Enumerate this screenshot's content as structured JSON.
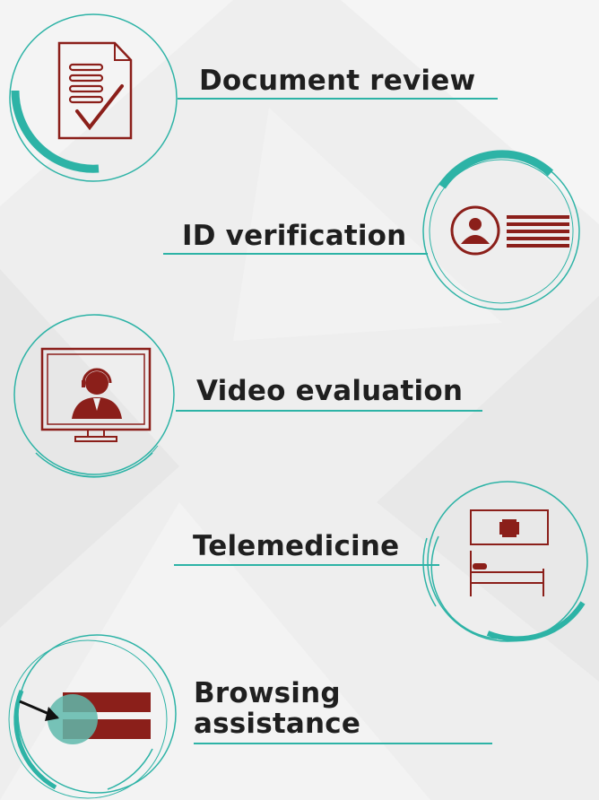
{
  "colors": {
    "background": "#eeeeee",
    "teal": "#2db3a6",
    "teal_light": "#7fd0c8",
    "maroon": "#8b1f1a",
    "text": "#1f1f1f"
  },
  "items": [
    {
      "label": "Document review",
      "icon": "document-check-icon"
    },
    {
      "label": "ID verification",
      "icon": "id-card-icon"
    },
    {
      "label": "Video evaluation",
      "icon": "video-call-monitor-icon"
    },
    {
      "label": "Telemedicine",
      "icon": "hospital-bed-icon"
    },
    {
      "label_line1": "Browsing",
      "label_line2": "assistance",
      "icon": "screen-pointer-icon"
    }
  ]
}
